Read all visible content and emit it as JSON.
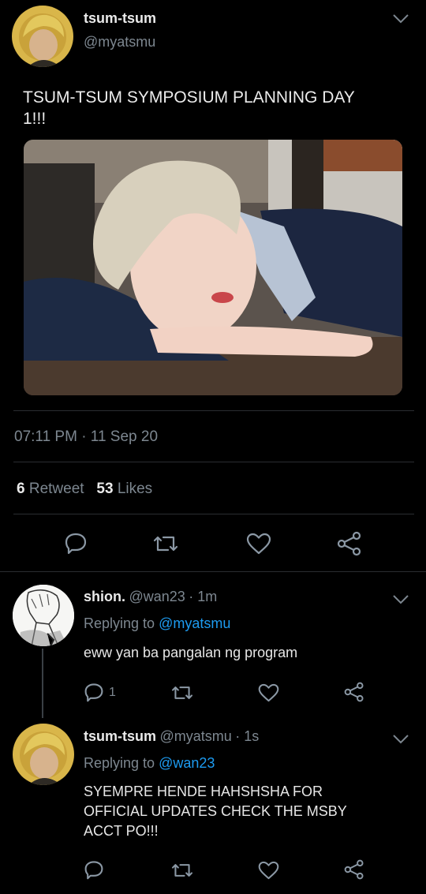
{
  "main_tweet": {
    "display_name": "tsum-tsum",
    "handle": "@myatsmu",
    "text_line1": "TSUM-TSUM SYMPOSIUM PLANNING DAY",
    "text_line2": "1!!!",
    "timestamp": "07:11 PM · 11 Sep 20",
    "retweet_count": "6",
    "retweet_label": "Retweet",
    "like_count": "53",
    "like_label": "Likes"
  },
  "reply1": {
    "display_name": "shion.",
    "handle": "@wan23",
    "time": "· 1m",
    "replying_prefix": "Replying to",
    "replying_to": "@myatsmu",
    "text": "eww yan ba pangalan ng program",
    "reply_count": "1"
  },
  "reply2": {
    "display_name": "tsum-tsum",
    "handle": "@myatsmu",
    "time": "· 1s",
    "replying_prefix": "Replying to",
    "replying_to": "@wan23",
    "text_lines": [
      "SYEMPRE HENDE HAHSHSHA FOR",
      "OFFICIAL UPDATES CHECK THE MSBY",
      "ACCT PO!!!"
    ]
  },
  "colors": {
    "background": "#000000",
    "accent_link": "#1d9bf0",
    "muted_text": "#7d8790",
    "icon": "#8b98a5"
  },
  "icons": [
    "chevron-down-icon",
    "reply-icon",
    "retweet-icon",
    "like-icon",
    "share-icon"
  ]
}
